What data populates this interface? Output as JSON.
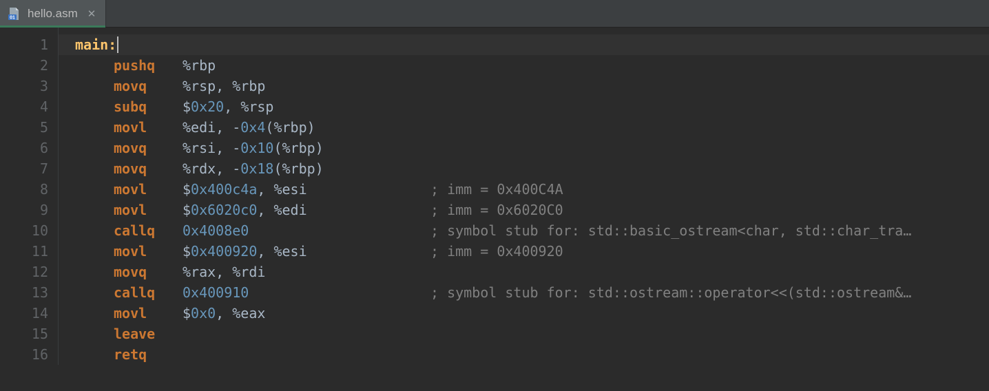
{
  "tab": {
    "filename": "hello.asm",
    "icon": "asm-file-icon"
  },
  "gutter": {
    "start": 1,
    "end": 16
  },
  "code": {
    "lines": [
      {
        "n": 1,
        "indent": 0,
        "label": "main:",
        "caret": true
      },
      {
        "n": 2,
        "indent": 1,
        "mnemonic": "pushq",
        "args": [
          {
            "t": "reg",
            "v": "%rbp"
          }
        ]
      },
      {
        "n": 3,
        "indent": 1,
        "mnemonic": "movq",
        "args": [
          {
            "t": "reg",
            "v": "%rsp"
          },
          {
            "t": "p",
            "v": ", "
          },
          {
            "t": "reg",
            "v": "%rbp"
          }
        ]
      },
      {
        "n": 4,
        "indent": 1,
        "mnemonic": "subq",
        "args": [
          {
            "t": "p",
            "v": "$"
          },
          {
            "t": "hex",
            "v": "0x20"
          },
          {
            "t": "p",
            "v": ", "
          },
          {
            "t": "reg",
            "v": "%rsp"
          }
        ]
      },
      {
        "n": 5,
        "indent": 1,
        "mnemonic": "movl",
        "args": [
          {
            "t": "reg",
            "v": "%edi"
          },
          {
            "t": "p",
            "v": ", -"
          },
          {
            "t": "hex",
            "v": "0x4"
          },
          {
            "t": "p",
            "v": "("
          },
          {
            "t": "reg",
            "v": "%rbp"
          },
          {
            "t": "p",
            "v": ")"
          }
        ]
      },
      {
        "n": 6,
        "indent": 1,
        "mnemonic": "movq",
        "args": [
          {
            "t": "reg",
            "v": "%rsi"
          },
          {
            "t": "p",
            "v": ", -"
          },
          {
            "t": "hex",
            "v": "0x10"
          },
          {
            "t": "p",
            "v": "("
          },
          {
            "t": "reg",
            "v": "%rbp"
          },
          {
            "t": "p",
            "v": ")"
          }
        ]
      },
      {
        "n": 7,
        "indent": 1,
        "mnemonic": "movq",
        "args": [
          {
            "t": "reg",
            "v": "%rdx"
          },
          {
            "t": "p",
            "v": ", -"
          },
          {
            "t": "hex",
            "v": "0x18"
          },
          {
            "t": "p",
            "v": "("
          },
          {
            "t": "reg",
            "v": "%rbp"
          },
          {
            "t": "p",
            "v": ")"
          }
        ]
      },
      {
        "n": 8,
        "indent": 1,
        "mnemonic": "movl",
        "args": [
          {
            "t": "p",
            "v": "$"
          },
          {
            "t": "hex",
            "v": "0x400c4a"
          },
          {
            "t": "p",
            "v": ", "
          },
          {
            "t": "reg",
            "v": "%esi"
          }
        ],
        "comment": "; imm = 0x400C4A"
      },
      {
        "n": 9,
        "indent": 1,
        "mnemonic": "movl",
        "args": [
          {
            "t": "p",
            "v": "$"
          },
          {
            "t": "hex",
            "v": "0x6020c0"
          },
          {
            "t": "p",
            "v": ", "
          },
          {
            "t": "reg",
            "v": "%edi"
          }
        ],
        "comment": "; imm = 0x6020C0"
      },
      {
        "n": 10,
        "indent": 1,
        "mnemonic": "callq",
        "args": [
          {
            "t": "hex",
            "v": "0x4008e0"
          }
        ],
        "comment": "; symbol stub for: std::basic_ostream<char, std::char_tra…"
      },
      {
        "n": 11,
        "indent": 1,
        "mnemonic": "movl",
        "args": [
          {
            "t": "p",
            "v": "$"
          },
          {
            "t": "hex",
            "v": "0x400920"
          },
          {
            "t": "p",
            "v": ", "
          },
          {
            "t": "reg",
            "v": "%esi"
          }
        ],
        "comment": "; imm = 0x400920"
      },
      {
        "n": 12,
        "indent": 1,
        "mnemonic": "movq",
        "args": [
          {
            "t": "reg",
            "v": "%rax"
          },
          {
            "t": "p",
            "v": ", "
          },
          {
            "t": "reg",
            "v": "%rdi"
          }
        ]
      },
      {
        "n": 13,
        "indent": 1,
        "mnemonic": "callq",
        "args": [
          {
            "t": "hex",
            "v": "0x400910"
          }
        ],
        "comment": "; symbol stub for: std::ostream::operator<<(std::ostream&…"
      },
      {
        "n": 14,
        "indent": 1,
        "mnemonic": "movl",
        "args": [
          {
            "t": "p",
            "v": "$"
          },
          {
            "t": "hex",
            "v": "0x0"
          },
          {
            "t": "p",
            "v": ", "
          },
          {
            "t": "reg",
            "v": "%eax"
          }
        ]
      },
      {
        "n": 15,
        "indent": 1,
        "mnemonic": "leave"
      },
      {
        "n": 16,
        "indent": 1,
        "mnemonic": "retq"
      }
    ]
  },
  "colors": {
    "bg": "#2b2b2b",
    "tabbar": "#3c3f41",
    "mnemonic": "#cc7832",
    "label": "#ffc66d",
    "number": "#6897bb",
    "comment": "#808080",
    "text": "#a9b7c6"
  }
}
